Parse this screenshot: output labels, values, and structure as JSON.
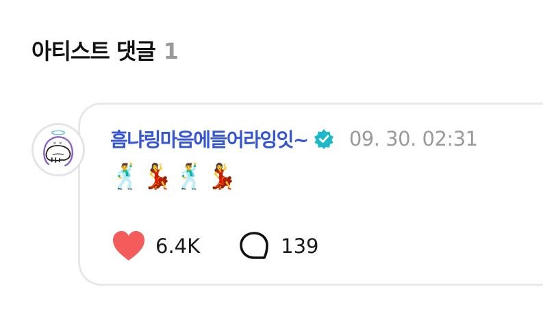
{
  "section": {
    "title": "아티스트 댓글",
    "count": "1"
  },
  "comment": {
    "author": "흠냐링마음에들어라잉잇~",
    "verified_icon": "verified-badge-icon",
    "verified_color": "#1db8c9",
    "timestamp": "09. 30. 02:31",
    "body": "🕺💃🕺💃",
    "avatar_icon": "doodle-ghost-avatar",
    "likes": {
      "icon": "heart-icon",
      "color": "#f45b5b",
      "count": "6.4K"
    },
    "replies": {
      "icon": "speech-bubble-icon",
      "count": "139"
    }
  }
}
